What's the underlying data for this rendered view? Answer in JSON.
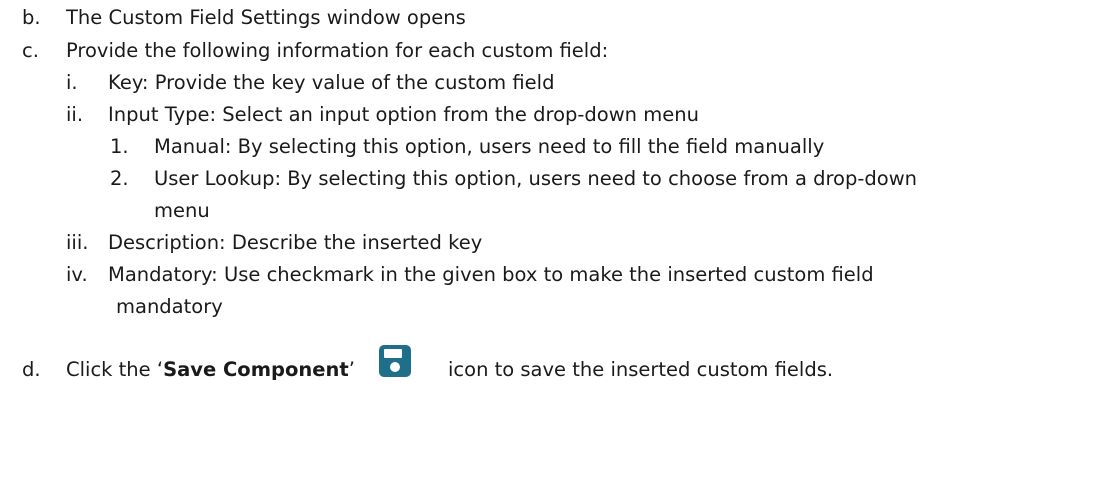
{
  "list": {
    "b": {
      "marker": "b.",
      "text": "The Custom Field Settings window opens"
    },
    "c": {
      "marker": "c.",
      "text": "Provide the following information for each custom field:"
    },
    "c_i": {
      "marker": "i.",
      "text": "Key: Provide the key value of the custom field"
    },
    "c_ii": {
      "marker": "ii.",
      "text": "Input Type: Select an input option from the drop-down menu"
    },
    "c_ii_1": {
      "marker": "1.",
      "text": "Manual: By selecting this option, users need to fill the field manually"
    },
    "c_ii_2": {
      "marker": "2.",
      "text": "User Lookup: By selecting this option, users need to choose from a drop-down",
      "text_cont": "menu"
    },
    "c_iii": {
      "marker": "iii.",
      "text": "Description: Describe the inserted key"
    },
    "c_iv": {
      "marker": "iv.",
      "text": "Mandatory: Use checkmark in the given box to make the inserted custom field",
      "text_cont": "mandatory"
    },
    "d": {
      "marker": "d.",
      "prefix": "Click the ‘",
      "bold": "Save Component",
      "suffix": "’",
      "after_icon": "icon to save the inserted custom fields."
    }
  },
  "icon": {
    "name": "floppy-disk-icon",
    "color": "#1f6f8b"
  }
}
